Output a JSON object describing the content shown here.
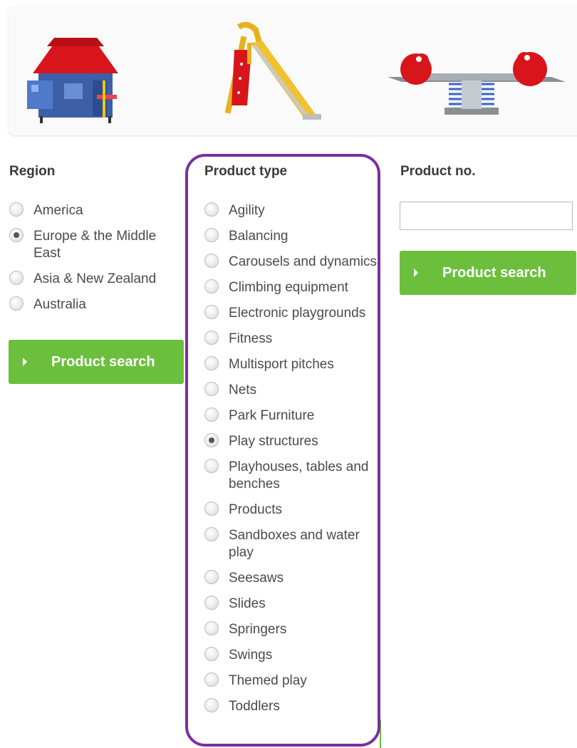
{
  "banner": {
    "images": [
      "playhouse",
      "slide",
      "seesaw"
    ]
  },
  "region": {
    "title": "Region",
    "options": [
      {
        "label": "America",
        "checked": false
      },
      {
        "label": "Europe & the Middle East",
        "checked": true
      },
      {
        "label": "Asia & New Zealand",
        "checked": false
      },
      {
        "label": "Australia",
        "checked": false
      }
    ],
    "button_label": "Product search"
  },
  "product_type": {
    "title": "Product type",
    "options": [
      {
        "label": "Agility",
        "checked": false
      },
      {
        "label": "Balancing",
        "checked": false
      },
      {
        "label": "Carousels and dynamics",
        "checked": false
      },
      {
        "label": "Climbing equipment",
        "checked": false
      },
      {
        "label": "Electronic playgrounds",
        "checked": false
      },
      {
        "label": "Fitness",
        "checked": false
      },
      {
        "label": "Multisport pitches",
        "checked": false
      },
      {
        "label": "Nets",
        "checked": false
      },
      {
        "label": "Park Furniture",
        "checked": false
      },
      {
        "label": "Play structures",
        "checked": true
      },
      {
        "label": "Playhouses, tables and benches",
        "checked": false
      },
      {
        "label": "Products",
        "checked": false
      },
      {
        "label": "Sandboxes and water play",
        "checked": false
      },
      {
        "label": "Seesaws",
        "checked": false
      },
      {
        "label": "Slides",
        "checked": false
      },
      {
        "label": "Springers",
        "checked": false
      },
      {
        "label": "Swings",
        "checked": false
      },
      {
        "label": "Themed play",
        "checked": false
      },
      {
        "label": "Toddlers",
        "checked": false
      }
    ]
  },
  "product_no": {
    "title": "Product no.",
    "value": "",
    "placeholder": "",
    "button_label": "Product search"
  },
  "colors": {
    "accent_green": "#6cbf3c",
    "highlight_purple": "#7b2fa0"
  }
}
